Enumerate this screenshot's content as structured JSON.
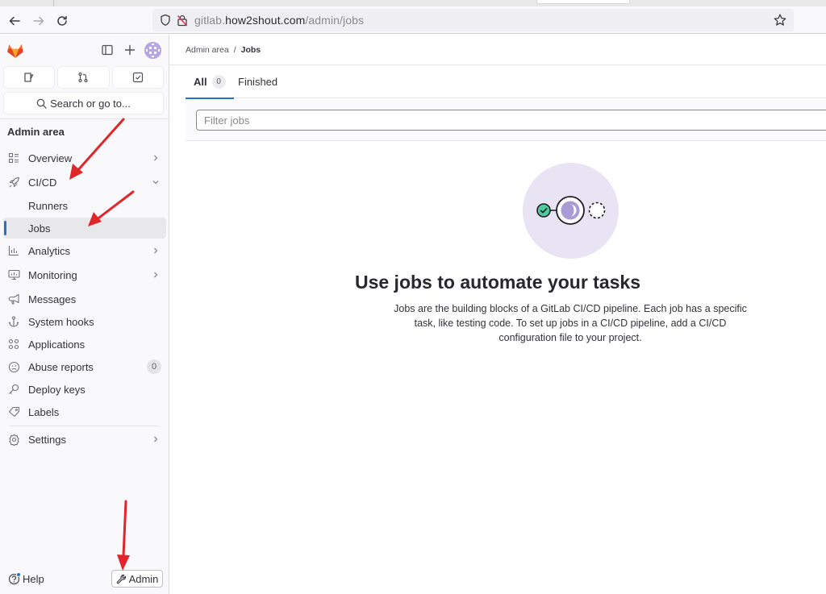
{
  "browser": {
    "url_host_prefix": "gitlab.",
    "url_host_main": "how2shout.com",
    "url_path": "/admin/jobs"
  },
  "sidebar": {
    "search_label": "Search or go to...",
    "section_heading": "Admin area",
    "items": [
      {
        "label": "Overview",
        "icon": "overview-icon",
        "chevron": "right"
      },
      {
        "label": "CI/CD",
        "icon": "rocket-icon",
        "chevron": "down"
      },
      {
        "label": "Runners",
        "sub": true
      },
      {
        "label": "Jobs",
        "sub": true,
        "active": true
      },
      {
        "label": "Analytics",
        "icon": "chart-icon",
        "chevron": "right"
      },
      {
        "label": "Monitoring",
        "icon": "monitor-icon",
        "chevron": "right"
      },
      {
        "label": "Messages",
        "icon": "megaphone-icon"
      },
      {
        "label": "System hooks",
        "icon": "anchor-icon"
      },
      {
        "label": "Applications",
        "icon": "applications-icon"
      },
      {
        "label": "Abuse reports",
        "icon": "abuse-icon",
        "badge": "0"
      },
      {
        "label": "Deploy keys",
        "icon": "key-icon"
      },
      {
        "label": "Labels",
        "icon": "label-icon"
      },
      {
        "label": "Settings",
        "icon": "settings-icon",
        "chevron": "right"
      }
    ],
    "help_label": "Help",
    "admin_label": "Admin"
  },
  "main": {
    "breadcrumb": {
      "parent": "Admin area",
      "separator": "/",
      "current": "Jobs"
    },
    "tabs": [
      {
        "label": "All",
        "count": "0",
        "active": true
      },
      {
        "label": "Finished"
      }
    ],
    "filter": {
      "placeholder": "Filter jobs",
      "value": ""
    },
    "empty_state": {
      "title": "Use jobs to automate your tasks",
      "description": "Jobs are the building blocks of a GitLab CI/CD pipeline. Each job has a specific task, like testing code. To set up jobs in a CI/CD pipeline, add a CI/CD configuration file to your project."
    }
  },
  "colors": {
    "accent": "#1f75cb",
    "annotation_arrow": "#e0262b",
    "illustration_bg": "#e8e4f4",
    "illustration_purple": "#a99bd6",
    "success_green": "#4fcba0"
  }
}
